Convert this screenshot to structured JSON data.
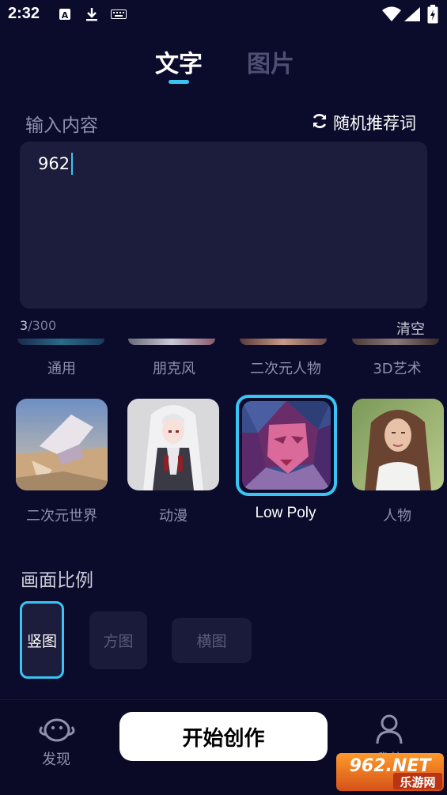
{
  "status_bar": {
    "time": "2:32"
  },
  "tabs": [
    {
      "label": "文字",
      "active": true
    },
    {
      "label": "图片",
      "active": false
    }
  ],
  "input": {
    "label": "输入内容",
    "random_label": "随机推荐词",
    "value": "962",
    "count_current": "3",
    "count_max": "/300",
    "clear_label": "清空"
  },
  "styles_row1": [
    {
      "label": "通用"
    },
    {
      "label": "朋克风"
    },
    {
      "label": "二次元人物"
    },
    {
      "label": "3D艺术"
    }
  ],
  "styles_row2": [
    {
      "label": "二次元世界",
      "selected": false
    },
    {
      "label": "动漫",
      "selected": false
    },
    {
      "label": "Low Poly",
      "selected": true
    },
    {
      "label": "人物",
      "selected": false
    }
  ],
  "ratio": {
    "title": "画面比例",
    "options": [
      {
        "label": "竖图",
        "selected": true
      },
      {
        "label": "方图",
        "selected": false
      },
      {
        "label": "横图",
        "selected": false
      }
    ]
  },
  "bottom_nav": {
    "discover_label": "发现",
    "start_label": "开始创作",
    "mine_label": "我的"
  },
  "watermark": {
    "text_top": "962.NET",
    "text_bottom": "乐游网"
  },
  "colors": {
    "background": "#0b0b2c",
    "accent": "#39c4f3",
    "panel": "#1c1c3d"
  }
}
